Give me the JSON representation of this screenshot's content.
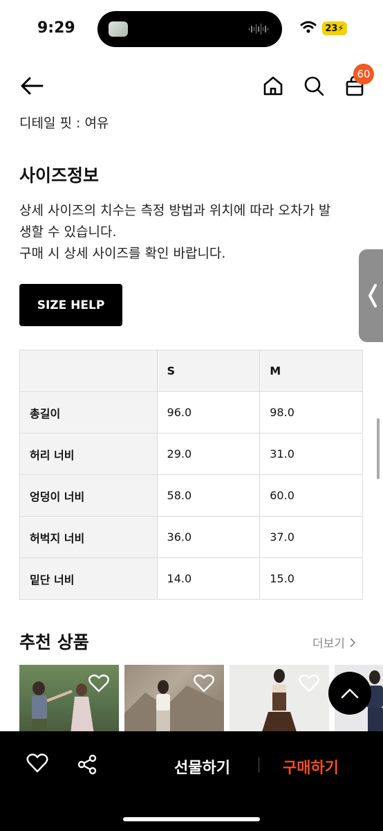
{
  "status_bar": {
    "time": "9:29",
    "battery": "23"
  },
  "header": {
    "cart_count": "60"
  },
  "detail_fit": "디테일 핏 : 여유",
  "size_info": {
    "title": "사이즈정보",
    "desc_line1": "상세 사이즈의 치수는 측정 방법과 위치에 따라 오차가 발",
    "desc_line2": "생할 수 있습니다.",
    "desc_line3": "구매 시 상세 사이즈를 확인 바랍니다.",
    "help_button": "SIZE HELP"
  },
  "size_table": {
    "columns": [
      "S",
      "M"
    ],
    "rows": [
      {
        "label": "총길이",
        "values": [
          "96.0",
          "98.0"
        ]
      },
      {
        "label": "허리 너비",
        "values": [
          "29.0",
          "31.0"
        ]
      },
      {
        "label": "엉덩이 너비",
        "values": [
          "58.0",
          "60.0"
        ]
      },
      {
        "label": "허벅지 너비",
        "values": [
          "36.0",
          "37.0"
        ]
      },
      {
        "label": "밑단 너비",
        "values": [
          "14.0",
          "15.0"
        ]
      }
    ]
  },
  "recommended": {
    "title": "추천 상품",
    "more": "더보기"
  },
  "bottom_bar": {
    "gift": "선물하기",
    "buy": "구매하기"
  },
  "colors": {
    "accent": "#f05a22",
    "buy": "#f0501e",
    "bar_bg": "#000000"
  },
  "icons": [
    "back-arrow-icon",
    "home-icon",
    "search-icon",
    "shopping-bag-icon",
    "heart-icon",
    "share-icon",
    "chevron-up-icon",
    "chevron-left-icon",
    "chevron-right-icon",
    "wifi-icon"
  ]
}
